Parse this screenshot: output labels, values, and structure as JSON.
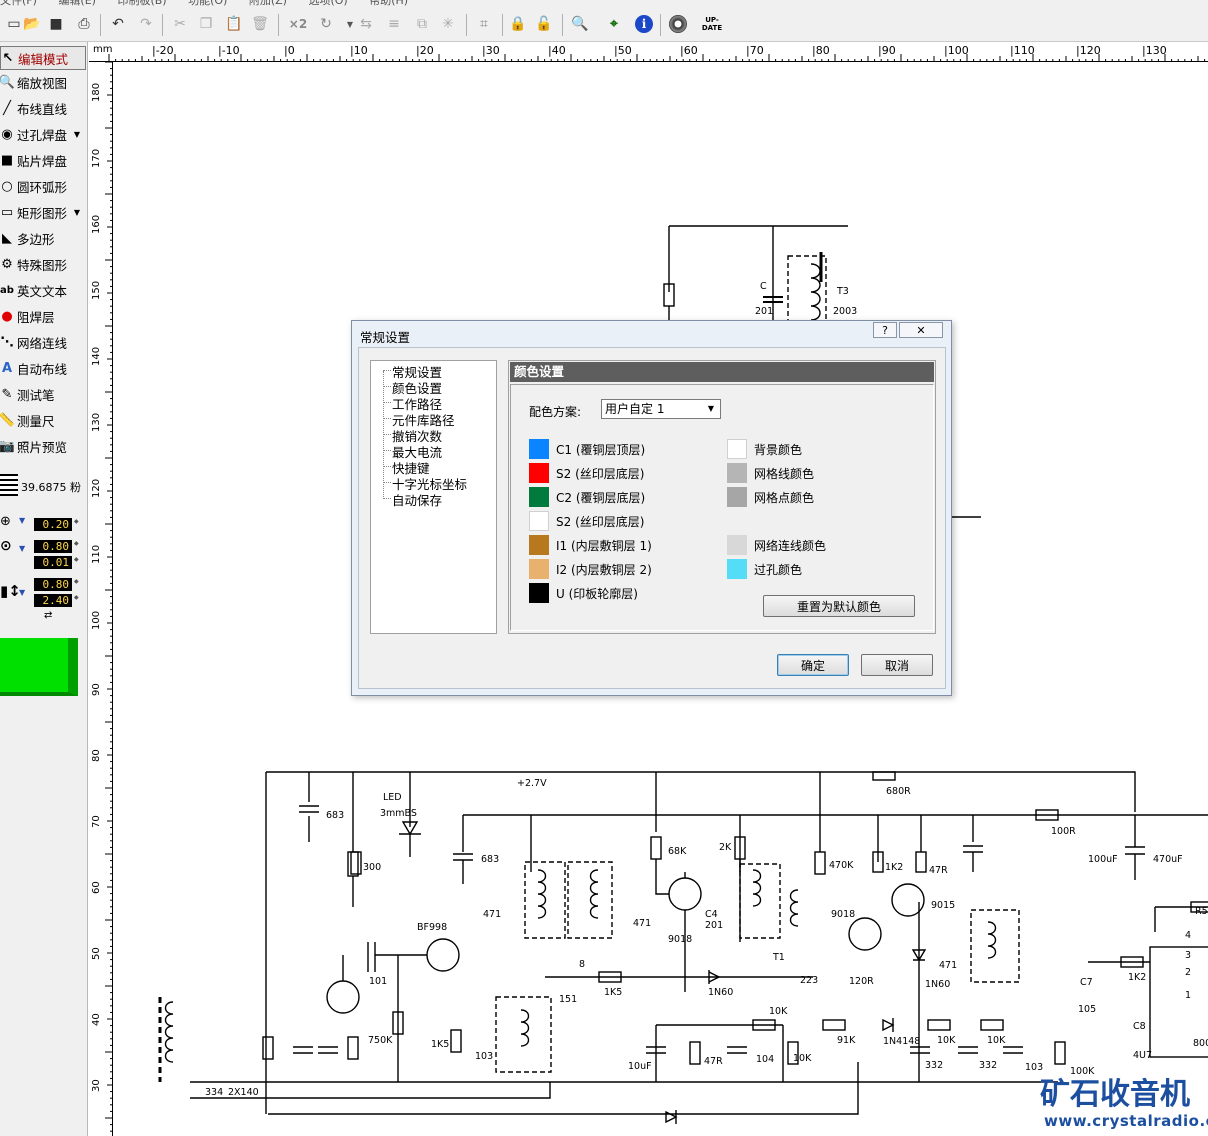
{
  "menubar": {
    "items": [
      "文件(F)",
      "编辑(E)",
      "印制板(B)",
      "功能(O)",
      "附加(Z)",
      "选项(O)",
      "帮助(H)"
    ]
  },
  "toolbar": {
    "icons": [
      "new-icon",
      "open-icon",
      "save-icon",
      "print-icon",
      "undo-icon",
      "redo-icon",
      "cut-icon",
      "copy-icon",
      "paste-icon",
      "delete-icon",
      "duplicate-x2-icon",
      "rotate-icon",
      "mirror-icon",
      "align-icon",
      "group-icon",
      "component-icon",
      "net-icon",
      "lock-icon",
      "unlock-icon",
      "zoom-icon",
      "snap-icon",
      "info-icon",
      "gear-icon",
      "update-icon"
    ],
    "x2_label": "×2",
    "update_label": "UP-\nDATE"
  },
  "sidebar": {
    "tools": [
      {
        "label": "编辑模式",
        "icon": "pointer-icon",
        "active": true
      },
      {
        "label": "缩放视图",
        "icon": "magnifier-icon"
      },
      {
        "label": "布线直线",
        "icon": "line-icon"
      },
      {
        "label": "过孔焊盘",
        "icon": "via-pad-icon",
        "caret": true
      },
      {
        "label": "贴片焊盘",
        "icon": "smd-pad-icon"
      },
      {
        "label": "圆环弧形",
        "icon": "circle-icon"
      },
      {
        "label": "矩形图形",
        "icon": "rectangle-icon",
        "caret": true
      },
      {
        "label": "多边形",
        "icon": "polygon-icon"
      },
      {
        "label": "特殊图形",
        "icon": "special-shape-icon"
      },
      {
        "label": "英文文本",
        "icon": "text-icon"
      },
      {
        "label": "阻焊层",
        "icon": "solder-mask-icon"
      },
      {
        "label": "网络连线",
        "icon": "net-link-icon"
      },
      {
        "label": "自动布线",
        "icon": "autoroute-icon"
      },
      {
        "label": "测试笔",
        "icon": "probe-icon"
      },
      {
        "label": "测量尺",
        "icon": "ruler-icon"
      },
      {
        "label": "照片预览",
        "icon": "photo-icon"
      }
    ],
    "grid_value": "39.6875 粉",
    "track_width": "0.20",
    "pad_outer": "0.80",
    "pad_inner": "0.01",
    "smd_w": "0.80",
    "smd_h": "2.40",
    "layer_color": "#00e000"
  },
  "ruler": {
    "unit": "mm",
    "h_labels": [
      "-20",
      "-10",
      "0",
      "10",
      "20",
      "30",
      "40",
      "50",
      "60",
      "70",
      "80",
      "90",
      "100",
      "110",
      "120",
      "130"
    ],
    "v_labels": [
      "180",
      "170",
      "160",
      "150",
      "140",
      "130",
      "120",
      "110",
      "100",
      "90",
      "80",
      "70",
      "60",
      "50",
      "40",
      "30"
    ]
  },
  "dialog": {
    "title": "常规设置",
    "help_btn": "?",
    "close_btn": "✕",
    "tree": [
      "常规设置",
      "颜色设置",
      "工作路径",
      "元件库路径",
      "撤销次数",
      "最大电流",
      "快捷键",
      "十字光标坐标",
      "自动保存"
    ],
    "panel_title": "颜色设置",
    "scheme_label": "配色方案:",
    "scheme_value": "用户自定 1",
    "left_colors": [
      {
        "label": "C1 (覆铜层顶层)",
        "color": "#0a84ff"
      },
      {
        "label": "S2 (丝印层底层)",
        "color": "#ff0000"
      },
      {
        "label": "C2 (覆铜层底层)",
        "color": "#007a3d"
      },
      {
        "label": "S2 (丝印层底层)",
        "color": "#ffffff"
      },
      {
        "label": "I1 (内层敷铜层 1)",
        "color": "#b8781e"
      },
      {
        "label": "I2 (内层敷铜层 2)",
        "color": "#e8b26e"
      },
      {
        "label": "U (印板轮廓层)",
        "color": "#000000"
      }
    ],
    "right_colors": [
      {
        "label": "背景颜色",
        "color": "#ffffff"
      },
      {
        "label": "网格线颜色",
        "color": "#b5b5b5"
      },
      {
        "label": "网格点颜色",
        "color": "#a6a6a6"
      },
      {
        "label": "网络连线颜色",
        "color": "#d8d8d8"
      },
      {
        "label": "过孔颜色",
        "color": "#55ddf8"
      }
    ],
    "reset_btn": "重置为默认颜色",
    "ok_btn": "确定",
    "cancel_btn": "取消"
  },
  "schematic": {
    "labels": [
      "+2.7V",
      "LED",
      "3mmBS",
      "683",
      "300",
      "683",
      "68K",
      "2K",
      "470K",
      "1K2",
      "47R",
      "9015",
      "680R",
      "100R",
      "100uF",
      "470uF",
      "BF998",
      "471",
      "471",
      "C4",
      "201",
      "9018",
      "T1",
      "9018",
      "8",
      "101",
      "1K5",
      "1N60",
      "223",
      "120R",
      "1N60",
      "471",
      "750K",
      "1K5",
      "103",
      "151",
      "10uF",
      "47R",
      "104",
      "10K",
      "10K",
      "91K",
      "1N4148",
      "10K",
      "10K",
      "100K",
      "332",
      "332",
      "103",
      "C7",
      "105",
      "1K2",
      "C8",
      "4U7",
      "R5",
      "4",
      "3",
      "2",
      "1",
      "800",
      "334",
      "2X140",
      "C",
      "201",
      "T3",
      "2003"
    ]
  },
  "watermark": {
    "logo": "矿石收音机",
    "url": "www.crystalradio.cn"
  }
}
